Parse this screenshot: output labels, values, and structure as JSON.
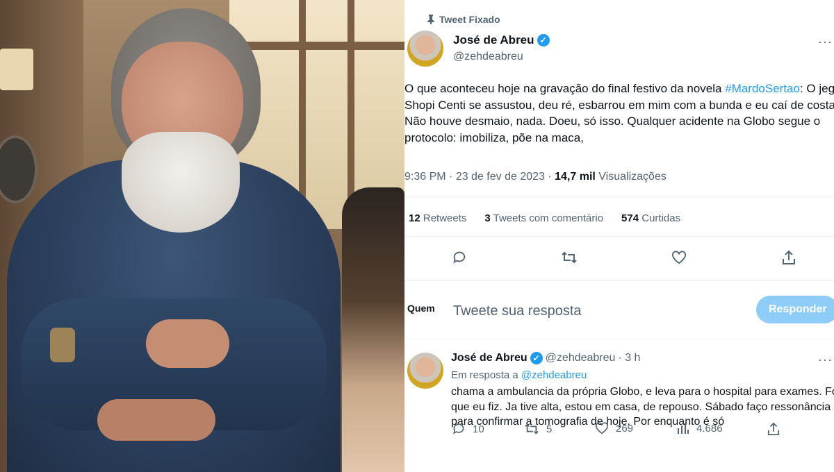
{
  "photo": {
    "alt": ""
  },
  "tweet": {
    "pinned_label": "Tweet Fixado",
    "author_name": "José de Abreu",
    "author_handle": "@zehdeabreu",
    "text_before": "O que aconteceu hoje na gravação do final festivo da novela",
    "hashtag": "#MardoSertao",
    "text_after": ": O jegue Shopi Centi se assustou, deu ré, esbarrou em mim com a bunda e eu caí de costas. Não houve desmaio, nada. Doeu, só isso. Qualquer acidente na Globo segue o protocolo: imobiliza, põe na maca,",
    "time": "9:36 PM",
    "date": "23 de fev de 2023",
    "views_count": "14,7 mil",
    "views_label": "Visualizações",
    "retweets_count": "12",
    "retweets_label": "Retweets",
    "quotes_count": "3",
    "quotes_label": "Tweets com comentário",
    "likes_count": "574",
    "likes_label": "Curtidas",
    "more": "···"
  },
  "reply_box": {
    "label": "Quem",
    "placeholder": "Tweete sua resposta",
    "button": "Responder"
  },
  "reply": {
    "author_name": "José de Abreu",
    "author_handle": "@zehdeabreu",
    "time": "· 3 h",
    "in_reply_prefix": "Em resposta a",
    "in_reply_handle": "@zehdeabreu",
    "text": "chama a ambulancia da própria Globo, e leva para o hospital para exames. Foi o que eu fiz. Ja tive alta, estou em casa, de repouso. Sábado faço ressonância para confirmar a tomografia de hoje. Por enquanto é só",
    "replies": "10",
    "retweets": "5",
    "likes": "269",
    "views": "4.686",
    "more": "···"
  },
  "colors": {
    "accent": "#1d9bf0",
    "text": "#0f1419",
    "secondary": "#536471"
  }
}
